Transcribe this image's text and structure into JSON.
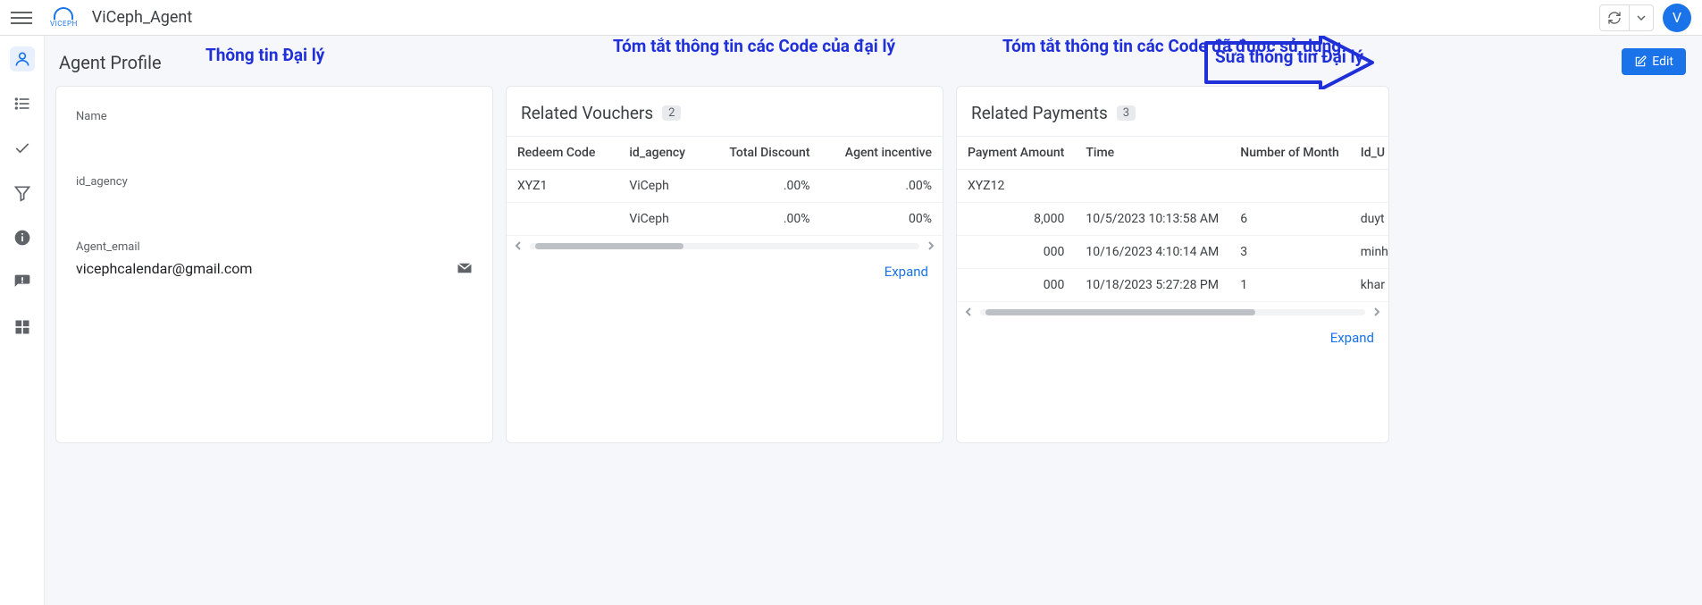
{
  "app_title": "ViCeph_Agent",
  "avatar_initial": "V",
  "page": {
    "title": "Agent Profile"
  },
  "annotations": {
    "a1": "Thông tin Đại lý",
    "a2": "Tóm tắt thông tin các Code của đại lý",
    "a3": "Tóm tắt thông tin các Code đã được sử dụng",
    "a4": "Sửa thông tin Đại lý"
  },
  "edit_label": "Edit",
  "profile": {
    "name_label": "Name",
    "name_value": "",
    "id_agency_label": "id_agency",
    "id_agency_value": "",
    "email_label": "Agent_email",
    "email_value": "vicephcalendar@gmail.com"
  },
  "vouchers": {
    "title": "Related Vouchers",
    "count": "2",
    "headers": [
      "Redeem Code",
      "id_agency",
      "Total Discount",
      "Agent incentive"
    ],
    "rows": [
      {
        "code": "XYZ1",
        "agency": "ViCeph",
        "discount": ".00%",
        "incentive": ".00%"
      },
      {
        "code": "",
        "agency": "ViCeph",
        "discount": ".00%",
        "incentive": "00%"
      }
    ],
    "expand": "Expand"
  },
  "payments": {
    "title": "Related Payments",
    "count": "3",
    "headers": [
      "Payment Amount",
      "Time",
      "Number of Month",
      "Id_U"
    ],
    "topcell": "XYZ12",
    "rows": [
      {
        "amount": "8,000",
        "time": "10/5/2023 10:13:58 AM",
        "months": "6",
        "idu": "duyt"
      },
      {
        "amount": "000",
        "time": "10/16/2023 4:10:14 AM",
        "months": "3",
        "idu": "minh"
      },
      {
        "amount": "000",
        "time": "10/18/2023 5:27:28 PM",
        "months": "1",
        "idu": "khar"
      }
    ],
    "expand": "Expand"
  }
}
